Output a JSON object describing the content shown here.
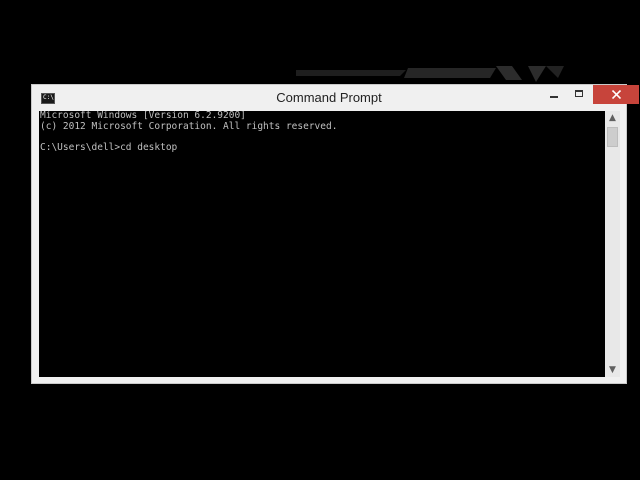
{
  "window": {
    "title": "Command Prompt",
    "icon": "cmd-icon",
    "icon_glyph": "C:\\",
    "controls": {
      "minimize_icon": "minimize-icon",
      "maximize_icon": "maximize-icon",
      "close_icon": "close-icon",
      "close_color": "#c7443b"
    }
  },
  "console": {
    "lines": [
      "Microsoft Windows [Version 6.2.9200]",
      "(c) 2012 Microsoft Corporation. All rights reserved.",
      "",
      "C:\\Users\\dell>cd desktop"
    ],
    "text_color": "#c0c0c0",
    "background_color": "#000000"
  },
  "scrollbar": {
    "up_arrow": "▲",
    "down_arrow": "▼",
    "position_fraction": 0
  }
}
